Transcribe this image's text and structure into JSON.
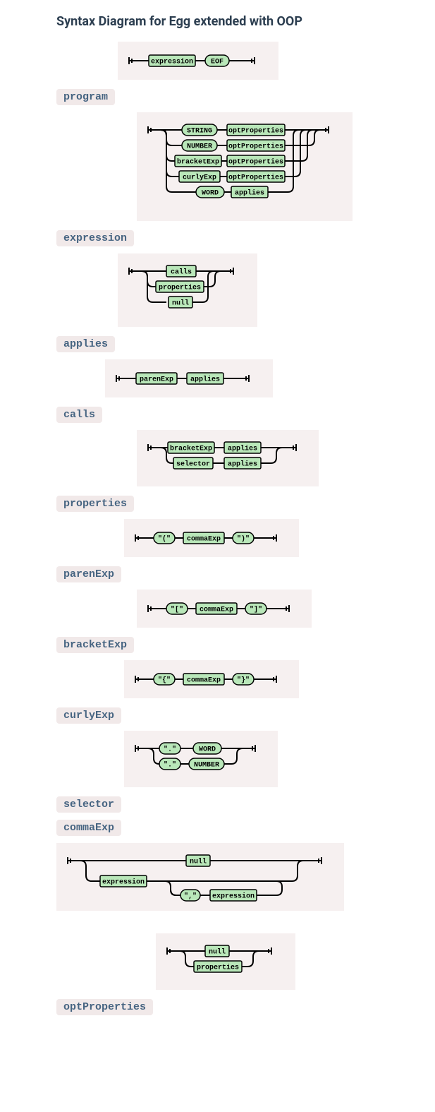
{
  "title": "Syntax Diagram for Egg extended with OOP",
  "rules": {
    "program": {
      "name": "program",
      "seq": [
        "expression",
        "EOF"
      ]
    },
    "expression": {
      "name": "expression",
      "alts": [
        [
          "STRING",
          "optProperties"
        ],
        [
          "NUMBER",
          "optProperties"
        ],
        [
          "bracketExp",
          "optProperties"
        ],
        [
          "curlyExp",
          "optProperties"
        ],
        [
          "WORD",
          "applies"
        ]
      ]
    },
    "applies": {
      "name": "applies",
      "alts": [
        "calls",
        "properties",
        "null"
      ]
    },
    "calls": {
      "name": "calls",
      "seq": [
        "parenExp",
        "applies"
      ]
    },
    "properties": {
      "name": "properties",
      "alts": [
        [
          "bracketExp",
          "applies"
        ],
        [
          "selector",
          "applies"
        ]
      ]
    },
    "parenExp": {
      "name": "parenExp",
      "seq": [
        "\"(\"",
        "commaExp",
        "\")\""
      ]
    },
    "bracketExp": {
      "name": "bracketExp",
      "seq": [
        "\"[\"",
        "commaExp",
        "\"]\""
      ]
    },
    "curlyExp": {
      "name": "curlyExp",
      "seq": [
        "\"{\"",
        "commaExp",
        "\"}\""
      ]
    },
    "selector": {
      "name": "selector",
      "alts": [
        [
          "\".\"",
          "WORD"
        ],
        [
          "\".\"",
          "NUMBER"
        ]
      ]
    },
    "commaExp": {
      "name": "commaExp",
      "alts": [
        "null",
        {
          "head": "expression",
          "loop": [
            "\",\"",
            "expression"
          ]
        }
      ]
    },
    "optProperties": {
      "name": "optProperties",
      "alts": [
        "null",
        "properties"
      ]
    }
  }
}
